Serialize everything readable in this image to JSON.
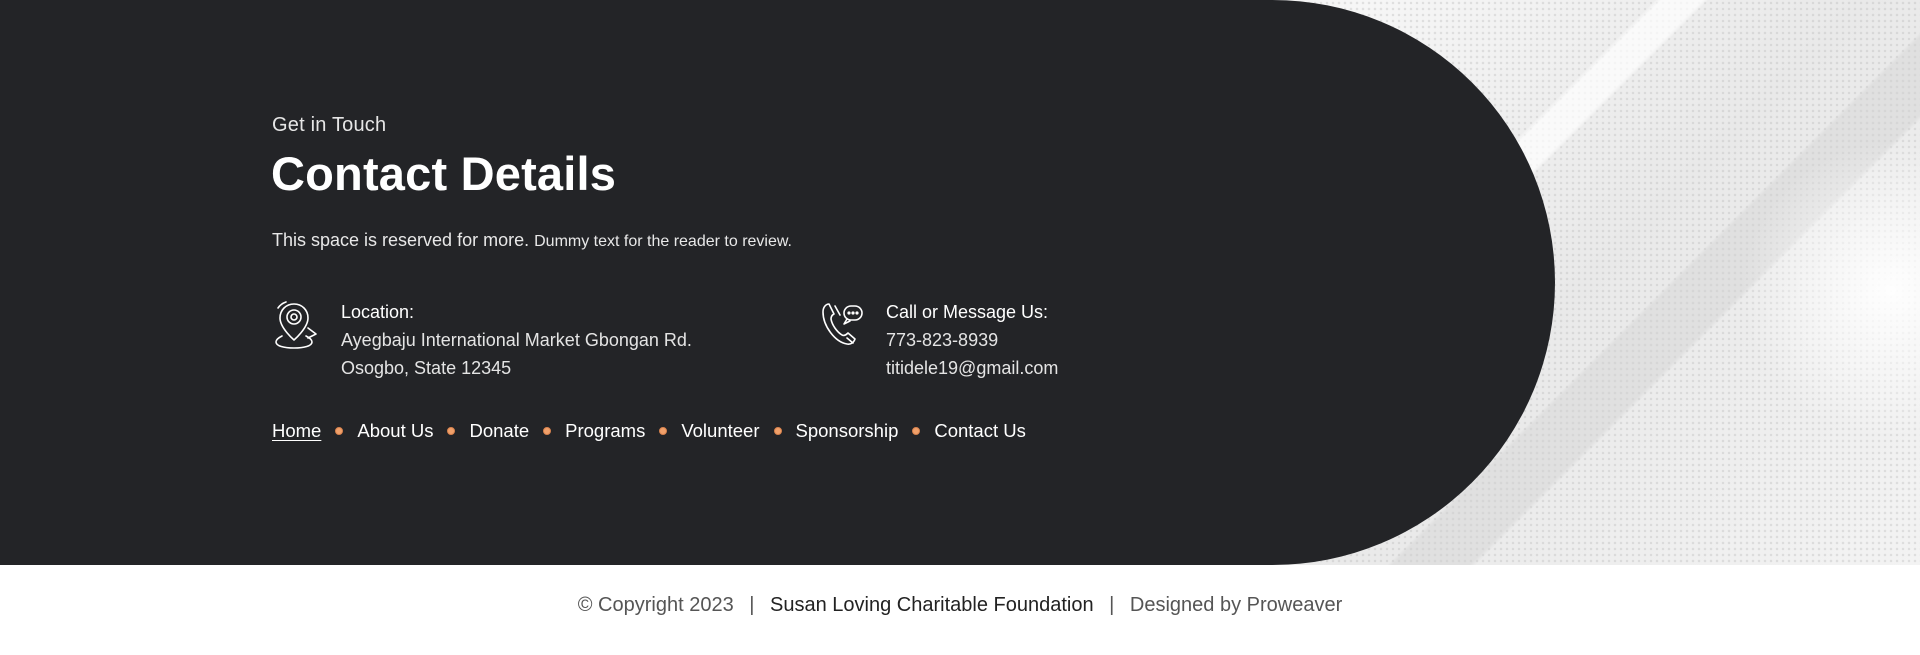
{
  "contact": {
    "eyebrow": "Get in Touch",
    "title": "Contact Details",
    "description_main": "This space is reserved for more.",
    "description_small": "Dummy text for the reader to review.",
    "location": {
      "icon": "location-pin-icon",
      "title": "Location:",
      "line1": "Ayegbaju International Market Gbongan Rd.",
      "line2": "Osogbo, State 12345"
    },
    "phone": {
      "icon": "phone-message-icon",
      "title": "Call or Message Us:",
      "number": "773-823-8939",
      "email": "titidele19@gmail.com"
    }
  },
  "nav": {
    "items": [
      {
        "label": "Home",
        "active": true
      },
      {
        "label": "About Us"
      },
      {
        "label": "Donate"
      },
      {
        "label": "Programs"
      },
      {
        "label": "Volunteer"
      },
      {
        "label": "Sponsorship"
      },
      {
        "label": "Contact Us"
      }
    ]
  },
  "footer": {
    "copyright": "© Copyright 2023",
    "separator": "|",
    "org_name": "Susan Loving Charitable Foundation",
    "credit": "Designed by Proweaver"
  },
  "colors": {
    "dark_panel": "#232427",
    "nav_dot": "#f0a06a",
    "text_light": "#ffffff"
  }
}
